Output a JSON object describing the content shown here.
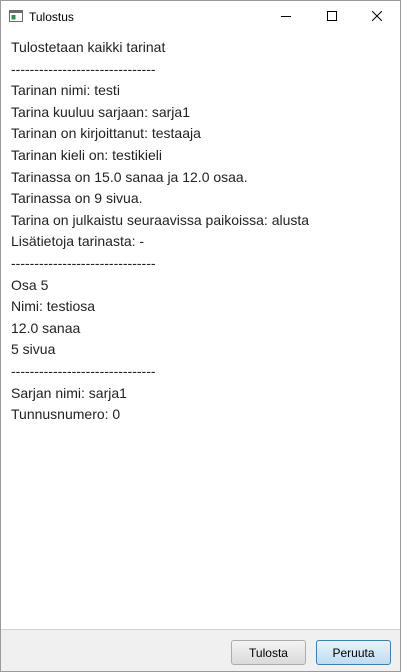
{
  "window": {
    "title": "Tulostus"
  },
  "titlebar_buttons": {
    "minimize_icon": "minimize-icon",
    "maximize_icon": "maximize-icon",
    "close_icon": "close-icon"
  },
  "report": {
    "lines": [
      "Tulostetaan kaikki tarinat",
      "-------------------------------",
      "Tarinan nimi: testi",
      "Tarina kuuluu sarjaan: sarja1",
      "Tarinan on kirjoittanut: testaaja",
      "Tarinan kieli on: testikieli",
      "Tarinassa on 15.0 sanaa ja 12.0 osaa.",
      "Tarinassa on 9 sivua.",
      "Tarina on julkaistu seuraavissa paikoissa: alusta",
      "Lisätietoja tarinasta: -",
      "-------------------------------",
      "Osa 5",
      "Nimi: testiosa",
      "12.0 sanaa",
      "5 sivua",
      "-------------------------------",
      "Sarjan nimi: sarja1",
      "Tunnusnumero: 0"
    ]
  },
  "buttons": {
    "print_label": "Tulosta",
    "cancel_label": "Peruuta"
  }
}
